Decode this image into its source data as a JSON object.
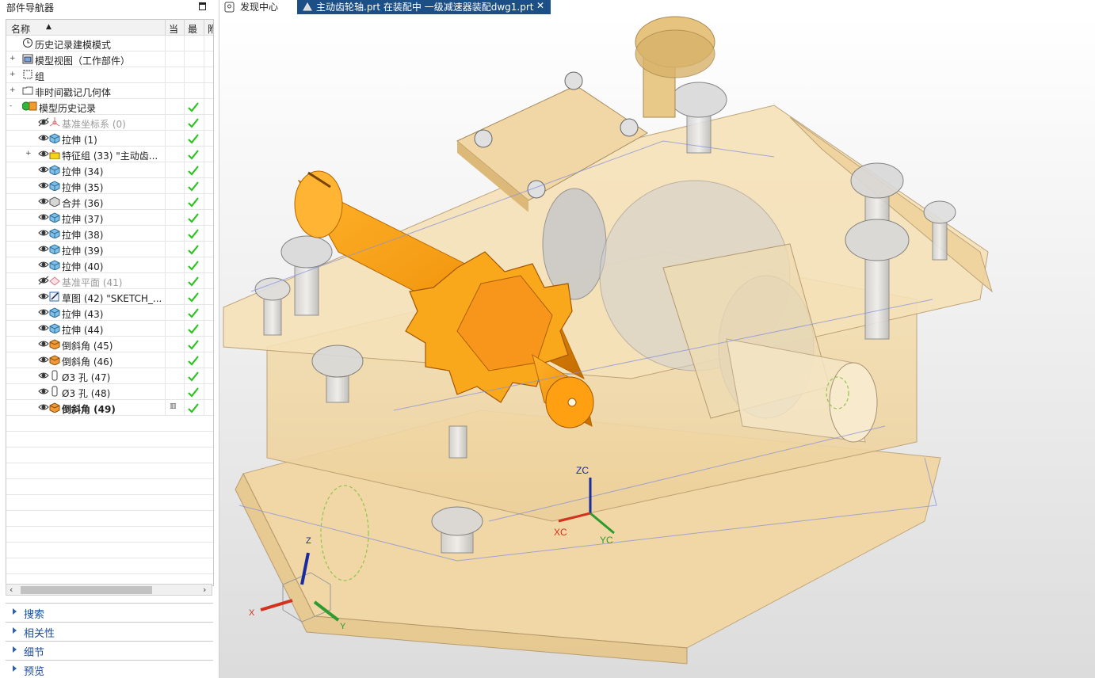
{
  "navigator": {
    "title": "部件导航器",
    "columns": {
      "name": "名称",
      "c1": "当",
      "c2": "最",
      "c3": "附"
    },
    "rows": [
      {
        "label": "历史记录建模模式",
        "indent": 1,
        "icon": "clock-icon",
        "expander": "",
        "style": "",
        "check": false
      },
      {
        "label": "模型视图（工作部件）",
        "indent": 1,
        "icon": "model-view-icon",
        "expander": "+",
        "style": "",
        "check": false
      },
      {
        "label": "组",
        "indent": 1,
        "icon": "group-icon",
        "expander": "+",
        "style": "",
        "check": false
      },
      {
        "label": "非时间戳记几何体",
        "indent": 1,
        "icon": "folder-icon",
        "expander": "+",
        "style": "",
        "check": false
      },
      {
        "label": "模型历史记录",
        "indent": 1,
        "icon": "history-icon",
        "expander": "-",
        "style": "",
        "check": true
      },
      {
        "label": "基准坐标系 (0)",
        "indent": 2,
        "icon": "datum-csys-icon",
        "expander": "",
        "style": "gray",
        "check": true
      },
      {
        "label": "拉伸 (1)",
        "indent": 2,
        "icon": "extrude-icon",
        "expander": "",
        "style": "",
        "check": true
      },
      {
        "label": "特征组 (33) \"主动齿...",
        "indent": 2,
        "icon": "feature-group-icon",
        "expander": "+",
        "style": "",
        "check": true
      },
      {
        "label": "拉伸 (34)",
        "indent": 2,
        "icon": "extrude-icon",
        "expander": "",
        "style": "",
        "check": true
      },
      {
        "label": "拉伸 (35)",
        "indent": 2,
        "icon": "extrude-icon",
        "expander": "",
        "style": "",
        "check": true
      },
      {
        "label": "合并 (36)",
        "indent": 2,
        "icon": "unite-icon",
        "expander": "",
        "style": "",
        "check": true
      },
      {
        "label": "拉伸 (37)",
        "indent": 2,
        "icon": "extrude-icon",
        "expander": "",
        "style": "",
        "check": true
      },
      {
        "label": "拉伸 (38)",
        "indent": 2,
        "icon": "extrude-icon",
        "expander": "",
        "style": "",
        "check": true
      },
      {
        "label": "拉伸 (39)",
        "indent": 2,
        "icon": "extrude-icon",
        "expander": "",
        "style": "",
        "check": true
      },
      {
        "label": "拉伸 (40)",
        "indent": 2,
        "icon": "extrude-icon",
        "expander": "",
        "style": "",
        "check": true
      },
      {
        "label": "基准平面 (41)",
        "indent": 2,
        "icon": "datum-plane-icon",
        "expander": "",
        "style": "gray",
        "check": true
      },
      {
        "label": "草图 (42) \"SKETCH_...",
        "indent": 2,
        "icon": "sketch-icon",
        "expander": "",
        "style": "",
        "check": true
      },
      {
        "label": "拉伸 (43)",
        "indent": 2,
        "icon": "extrude-icon",
        "expander": "",
        "style": "",
        "check": true
      },
      {
        "label": "拉伸 (44)",
        "indent": 2,
        "icon": "extrude-icon",
        "expander": "",
        "style": "",
        "check": true
      },
      {
        "label": "倒斜角 (45)",
        "indent": 2,
        "icon": "chamfer-icon",
        "expander": "",
        "style": "",
        "check": true
      },
      {
        "label": "倒斜角 (46)",
        "indent": 2,
        "icon": "chamfer-icon",
        "expander": "",
        "style": "",
        "check": true
      },
      {
        "label": "Ø3 孔 (47)",
        "indent": 2,
        "icon": "hole-icon",
        "expander": "",
        "style": "",
        "check": true
      },
      {
        "label": "Ø3 孔 (48)",
        "indent": 2,
        "icon": "hole-icon",
        "expander": "",
        "style": "",
        "check": true
      },
      {
        "label": "倒斜角 (49)",
        "indent": 2,
        "icon": "chamfer-icon",
        "expander": "",
        "style": "bold",
        "check": true
      }
    ],
    "panels": [
      "搜索",
      "相关性",
      "细节",
      "预览"
    ]
  },
  "tabs": [
    {
      "label": "发现中心",
      "active": false
    },
    {
      "label": "主动齿轮轴.prt 在装配中 一级减速器装配dwg1.prt",
      "active": true
    }
  ],
  "axes": {
    "zc": "ZC",
    "xc": "XC",
    "yc": "YC",
    "z": "Z",
    "x": "X",
    "y": "Y"
  },
  "colors": {
    "accent": "#1c4f86",
    "gear": "#f39a12",
    "housing": "#f2d9a8",
    "check": "#2bc41e"
  }
}
